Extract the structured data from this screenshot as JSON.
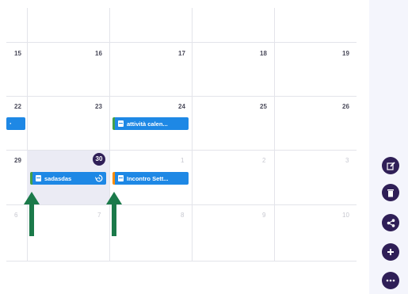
{
  "calendar": {
    "rows": [
      {
        "days": [
          {
            "label": "15",
            "muted": false
          },
          {
            "label": "16",
            "muted": false
          },
          {
            "label": "17",
            "muted": false
          },
          {
            "label": "18",
            "muted": false
          },
          {
            "label": "19",
            "muted": false
          }
        ]
      },
      {
        "days": [
          {
            "label": "22",
            "muted": false
          },
          {
            "label": "23",
            "muted": false
          },
          {
            "label": "24",
            "muted": false
          },
          {
            "label": "25",
            "muted": false
          },
          {
            "label": "26",
            "muted": false
          }
        ]
      },
      {
        "days": [
          {
            "label": "29",
            "muted": false
          },
          {
            "label": "30",
            "muted": false,
            "today": true
          },
          {
            "label": "1",
            "muted": true
          },
          {
            "label": "2",
            "muted": true
          },
          {
            "label": "3",
            "muted": true
          }
        ]
      },
      {
        "days": [
          {
            "label": "6",
            "muted": true
          },
          {
            "label": "7",
            "muted": true
          },
          {
            "label": "8",
            "muted": true
          },
          {
            "label": "9",
            "muted": true
          },
          {
            "label": "10",
            "muted": true
          }
        ]
      }
    ],
    "events": {
      "e1": {
        "title": "attività calen...",
        "accent": "#43a047"
      },
      "e2": {
        "title": "sadasdas",
        "accent": "#43a047",
        "icon": "history-icon"
      },
      "e3": {
        "title": "Incontro Sett...",
        "accent": "#fb8c00"
      }
    }
  },
  "actions": [
    {
      "name": "edit-button",
      "icon": "edit-icon"
    },
    {
      "name": "delete-button",
      "icon": "trash-icon"
    },
    {
      "name": "share-button",
      "icon": "share-icon"
    },
    {
      "name": "add-button",
      "icon": "plus-icon"
    },
    {
      "name": "more-button",
      "icon": "more-icon"
    }
  ],
  "colors": {
    "accent": "#2f1f57",
    "event": "#1e88e5",
    "arrow": "#1b7a4a",
    "today_bg": "#ebebf4"
  }
}
